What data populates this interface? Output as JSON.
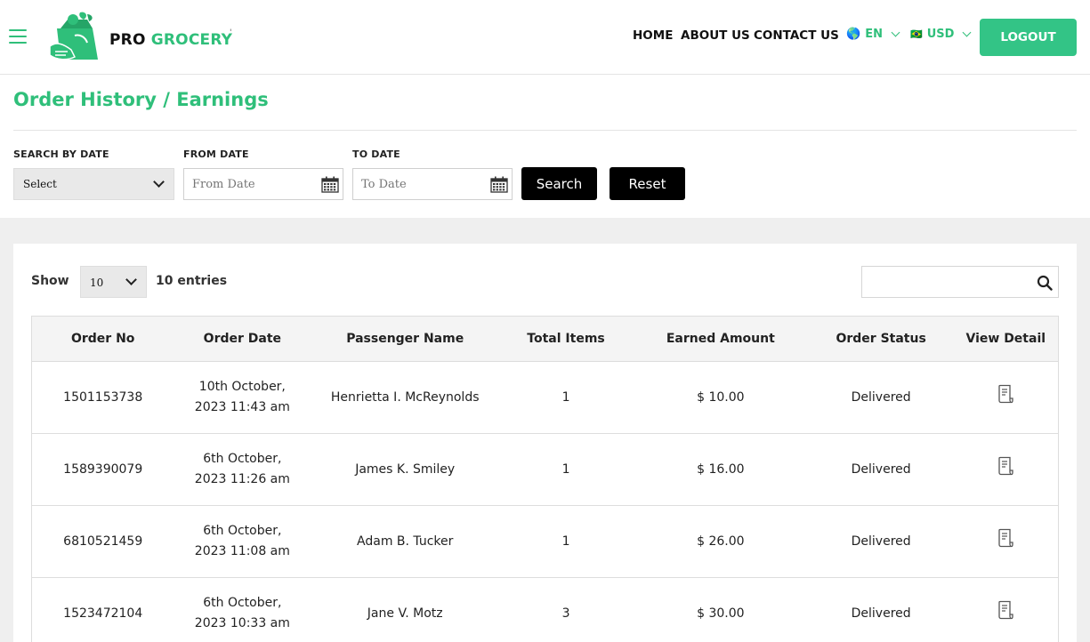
{
  "header": {
    "brand_pro": "PRO",
    "brand_grocery": "GROCERY",
    "brand_mark": "'",
    "nav": {
      "home": "HOME",
      "about": "ABOUT US",
      "contact": "CONTACT US"
    },
    "language": {
      "flag": "🌎",
      "label": "EN"
    },
    "currency": {
      "flag": "🇧🇷",
      "label": "USD"
    },
    "logout_label": "LOGOUT"
  },
  "page": {
    "title": "Order History / Earnings"
  },
  "filters": {
    "search_by_date_label": "SEARCH BY DATE",
    "search_by_date_value": "Select",
    "from_date_label": "FROM DATE",
    "from_date_placeholder": "From Date",
    "to_date_label": "TO DATE",
    "to_date_placeholder": "To Date",
    "search_label": "Search",
    "reset_label": "Reset"
  },
  "table_controls": {
    "show_label": "Show",
    "page_length": "10",
    "entries_label": "10 entries"
  },
  "table": {
    "columns": [
      "Order No",
      "Order Date",
      "Passenger Name",
      "Total Items",
      "Earned Amount",
      "Order Status",
      "View Detail"
    ],
    "rows": [
      {
        "order_no": "1501153738",
        "date": "10th October, 2023 11:43 am",
        "name": "Henrietta I. McReynolds",
        "items": "1",
        "amount": "$ 10.00",
        "status": "Delivered"
      },
      {
        "order_no": "1589390079",
        "date": "6th October, 2023 11:26 am",
        "name": "James K. Smiley",
        "items": "1",
        "amount": "$ 16.00",
        "status": "Delivered"
      },
      {
        "order_no": "6810521459",
        "date": "6th October, 2023 11:08 am",
        "name": "Adam B. Tucker",
        "items": "1",
        "amount": "$ 26.00",
        "status": "Delivered"
      },
      {
        "order_no": "1523472104",
        "date": "6th October, 2023 10:33 am",
        "name": "Jane V. Motz",
        "items": "3",
        "amount": "$ 30.00",
        "status": "Delivered"
      }
    ]
  },
  "colors": {
    "accent": "#2fbf7a",
    "logout_bg": "#33c486",
    "button_dark": "#000000"
  },
  "icons": {
    "menu": "hamburger-icon",
    "calendar": "calendar-icon",
    "search": "search-icon",
    "detail": "receipt-icon"
  }
}
